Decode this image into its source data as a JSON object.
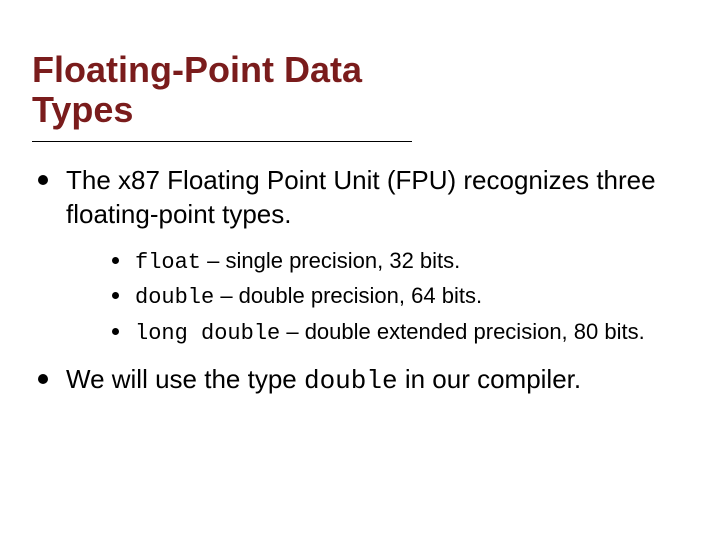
{
  "title": "Floating-Point Data Types",
  "bullets": {
    "b1": "The x87 Floating Point Unit (FPU) recognizes three floating-point types.",
    "sub1": {
      "code": "float",
      "rest": " – single precision, 32 bits."
    },
    "sub2": {
      "code": "double",
      "rest": " – double precision, 64 bits."
    },
    "sub3": {
      "code": "long double",
      "rest": " – double extended precision, 80 bits."
    },
    "b2_pre": "We will use the type ",
    "b2_code": "double",
    "b2_post": " in our compiler."
  }
}
